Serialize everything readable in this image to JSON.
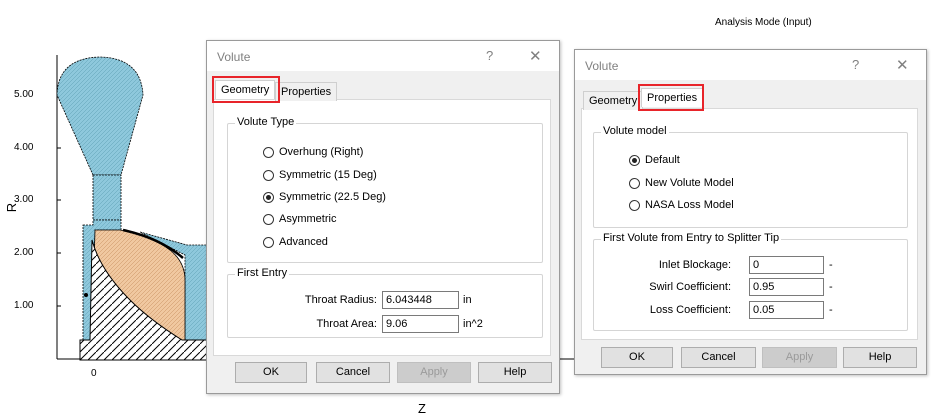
{
  "mode_label": "Analysis Mode (Input)",
  "plot": {
    "y_axis_label": "R",
    "x_axis_label": "Z",
    "y_ticks": [
      "5.00",
      "4.00",
      "3.00",
      "2.00",
      "1.00"
    ],
    "x_ticks": [
      "0"
    ],
    "colors": {
      "volute_fill": "#8ec8dc",
      "impeller_fill": "#f0c8a0",
      "outline": "#000000"
    }
  },
  "volute_dialog": {
    "title": "Volute",
    "help_glyph": "?",
    "close_glyph": "✕",
    "tabs": [
      "Geometry",
      "Properties"
    ],
    "active_tab": "Geometry",
    "volute_type": {
      "title": "Volute Type",
      "options": [
        "Overhung (Right)",
        "Symmetric (15 Deg)",
        "Symmetric (22.5 Deg)",
        "Asymmetric",
        "Advanced"
      ],
      "selected": "Symmetric (22.5 Deg)"
    },
    "first_entry": {
      "title": "First Entry",
      "throat_radius_label": "Throat Radius:",
      "throat_radius_value": "6.043448",
      "throat_radius_unit": "in",
      "throat_area_label": "Throat Area:",
      "throat_area_value": "9.06",
      "throat_area_unit": "in^2"
    },
    "buttons": {
      "ok": "OK",
      "cancel": "Cancel",
      "apply": "Apply",
      "help": "Help"
    }
  },
  "volute_dialog_props": {
    "title": "Volute",
    "help_glyph": "?",
    "close_glyph": "✕",
    "tabs": [
      "Geometry",
      "Properties"
    ],
    "active_tab": "Properties",
    "volute_model": {
      "title": "Volute model",
      "options": [
        "Default",
        "New Volute Model",
        "NASA Loss Model"
      ],
      "selected": "Default"
    },
    "first_volute": {
      "title": "First Volute from Entry to Splitter Tip",
      "inlet_blockage_label": "Inlet Blockage:",
      "inlet_blockage_value": "0",
      "swirl_coefficient_label": "Swirl Coefficient:",
      "swirl_coefficient_value": "0.95",
      "loss_coefficient_label": "Loss Coefficient:",
      "loss_coefficient_value": "0.05",
      "unit_dash": "-"
    },
    "buttons": {
      "ok": "OK",
      "cancel": "Cancel",
      "apply": "Apply",
      "help": "Help"
    }
  }
}
